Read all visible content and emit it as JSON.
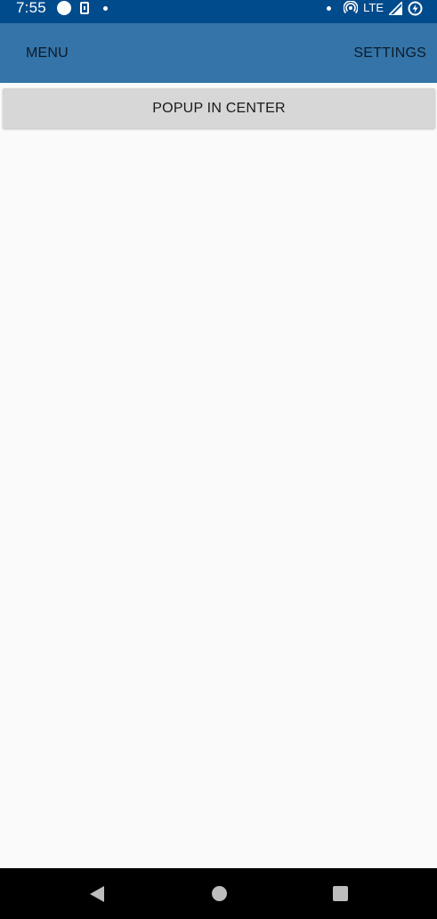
{
  "status_bar": {
    "time": "7:55",
    "network": "LTE",
    "icons": [
      "circle-notification-icon",
      "sim-card-icon",
      "dot-icon",
      "dot-icon",
      "hotspot-icon",
      "signal-icon",
      "battery-charging-icon"
    ]
  },
  "app_bar": {
    "menu_label": "MENU",
    "settings_label": "SETTINGS"
  },
  "main": {
    "popup_button_label": "POPUP IN CENTER"
  },
  "nav_bar": {
    "icons": [
      "back-icon",
      "home-icon",
      "recents-icon"
    ]
  },
  "colors": {
    "status_bar": "#004b8c",
    "app_bar": "#3474a8",
    "button": "#d7d7d7",
    "background": "#fafafa"
  }
}
